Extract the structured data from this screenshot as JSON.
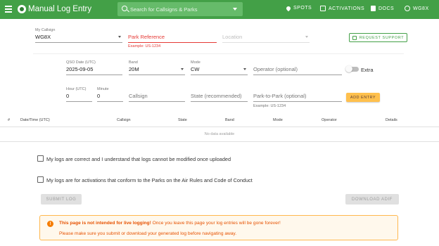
{
  "app": {
    "title": "Manual Log Entry"
  },
  "search": {
    "placeholder": "Search for Callsigns & Parks"
  },
  "nav": [
    {
      "label": "SPOTS",
      "icon": "map-pin-icon"
    },
    {
      "label": "ACTIVATIONS",
      "icon": "calendar-icon"
    },
    {
      "label": "DOCS",
      "icon": "document-icon"
    },
    {
      "label": "WG8X",
      "icon": "globe-icon"
    }
  ],
  "top_form": {
    "callsign": {
      "label": "My Callsign",
      "value": "WG8X"
    },
    "park": {
      "placeholder": "Park Reference",
      "hint": "Example: US-1234"
    },
    "location": {
      "placeholder": "Location"
    },
    "request_support": "REQUEST SUPPORT"
  },
  "qso_form": {
    "date": {
      "label": "QSO Date (UTC)",
      "value": "2025-09-05"
    },
    "band": {
      "label": "Band",
      "value": "20M"
    },
    "mode": {
      "label": "Mode",
      "value": "CW"
    },
    "operator": {
      "placeholder": "Operator (optional)"
    },
    "extra": "Extra",
    "hour": {
      "label": "Hour (UTC)",
      "value": "0"
    },
    "minute": {
      "label": "Minute",
      "value": "0"
    },
    "callsign": {
      "placeholder": "Callsign"
    },
    "state": {
      "placeholder": "State (recommended)"
    },
    "p2p": {
      "placeholder": "Park-to-Park (optional)",
      "hint": "Example: US-1234"
    },
    "add_entry": "ADD ENTRY"
  },
  "table": {
    "columns": [
      "#",
      "Date/Time (UTC)",
      "Callsign",
      "State",
      "Band",
      "Mode",
      "Operator",
      "Details"
    ],
    "empty_text": "No data available"
  },
  "checkboxes": [
    "My logs are correct and I understand that logs cannot be modified once uploaded",
    "My logs are for activations that conform to the Parks on the Air Rules and Code of Conduct"
  ],
  "actions": {
    "submit": "SUBMIT LOG",
    "download": "DOWNLOAD ADIF"
  },
  "alert": {
    "bold": "This page is not intended for live logging!",
    "rest": " Once you leave this page your log entries will be gone forever!",
    "line2": "Please make sure you submit or download your generated log before navigating away."
  },
  "colors": {
    "brand": "#43a047",
    "warning": "#f57c00",
    "park_error": "#e53935",
    "add_entry": "#ffc04d"
  }
}
